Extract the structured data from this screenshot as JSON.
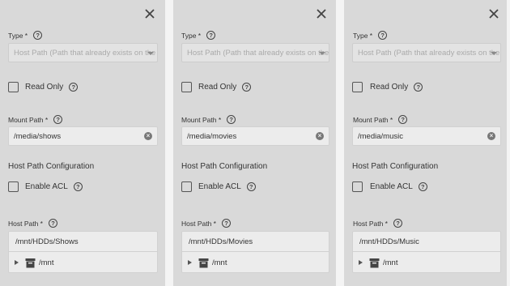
{
  "panels": [
    {
      "type_label": "Type *",
      "type_value": "Host Path (Path that already exists on the",
      "read_only_label": "Read Only",
      "mount_path_label": "Mount Path *",
      "mount_path_value": "/media/shows",
      "host_path_config_title": "Host Path Configuration",
      "enable_acl_label": "Enable ACL",
      "host_path_label": "Host Path *",
      "host_path_value": "/mnt/HDDs/Shows",
      "tree_root": "/mnt"
    },
    {
      "type_label": "Type *",
      "type_value": "Host Path (Path that already exists on the",
      "read_only_label": "Read Only",
      "mount_path_label": "Mount Path *",
      "mount_path_value": "/media/movies",
      "host_path_config_title": "Host Path Configuration",
      "enable_acl_label": "Enable ACL",
      "host_path_label": "Host Path *",
      "host_path_value": "/mnt/HDDs/Movies",
      "tree_root": "/mnt"
    },
    {
      "type_label": "Type *",
      "type_value": "Host Path (Path that already exists on the",
      "read_only_label": "Read Only",
      "mount_path_label": "Mount Path *",
      "mount_path_value": "/media/music",
      "host_path_config_title": "Host Path Configuration",
      "enable_acl_label": "Enable ACL",
      "host_path_label": "Host Path *",
      "host_path_value": "/mnt/HDDs/Music",
      "tree_root": "/mnt"
    }
  ],
  "help_glyph": "?",
  "clear_glyph": "×",
  "icons": {
    "close": "close-icon",
    "help": "help-circle-icon",
    "dropdown": "caret-down-icon",
    "clear": "clear-icon",
    "tree_expand": "tree-expand-icon",
    "folder": "dataset-icon"
  },
  "colors": {
    "panel_bg": "#d9d9d9",
    "page_bg": "#f4f4f4",
    "input_bg": "#ececec"
  }
}
